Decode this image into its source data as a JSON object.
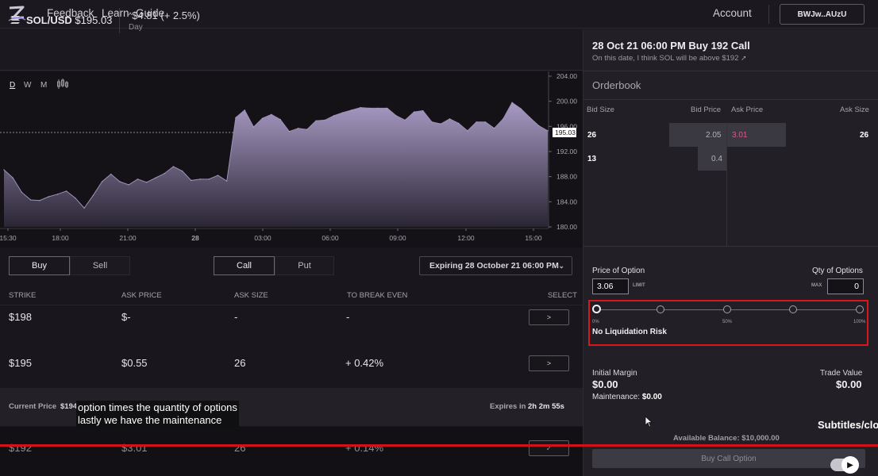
{
  "nav": {
    "links": [
      "Feedback",
      "Learn",
      "Guide"
    ],
    "account": "Account",
    "wallet": "BWJw..AUzU"
  },
  "ticker": {
    "pair": "SOL/USD",
    "price": "$195.03",
    "change": "$4.81 (+ 2.5%)",
    "period": "Day"
  },
  "timeframes": [
    "D",
    "W",
    "M"
  ],
  "chart_data": {
    "type": "area",
    "x_ticks": [
      "15:30",
      "18:00",
      "21:00",
      "28",
      "03:00",
      "06:00",
      "09:00",
      "12:00",
      "15:00"
    ],
    "y_ticks": [
      204.0,
      200.0,
      196.0,
      192.0,
      188.0,
      184.0,
      180.0
    ],
    "ylim": [
      180,
      204
    ],
    "current_label": "195.03",
    "current_value": 195.03,
    "values": [
      189.1,
      187.8,
      185.5,
      184.3,
      184.2,
      184.8,
      185.2,
      185.7,
      184.6,
      183.0,
      185.0,
      187.2,
      188.4,
      187.2,
      186.7,
      187.6,
      187.1,
      187.8,
      188.5,
      189.6,
      188.9,
      187.4,
      187.6,
      187.6,
      188.2,
      187.3,
      197.4,
      198.6,
      195.9,
      197.3,
      197.9,
      197.1,
      195.2,
      195.7,
      195.5,
      196.9,
      197.0,
      197.7,
      198.2,
      198.6,
      199.0,
      198.9,
      198.9,
      198.9,
      197.7,
      197.0,
      198.3,
      198.5,
      196.7,
      196.4,
      197.2,
      196.5,
      195.3,
      196.7,
      196.7,
      195.7,
      197.2,
      199.8,
      198.8,
      197.4,
      196.1,
      195.3
    ],
    "grid": false
  },
  "options": {
    "side": [
      "Buy",
      "Sell"
    ],
    "kind": [
      "Call",
      "Put"
    ],
    "expiry": "Expiring 28 October 21 06:00 PM",
    "headers": [
      "STRIKE",
      "ASK PRICE",
      "ASK SIZE",
      "TO BREAK EVEN",
      "SELECT"
    ],
    "rows": [
      {
        "strike": "$198",
        "ask": "$-",
        "size": "-",
        "breakeven": "-"
      },
      {
        "strike": "$195",
        "ask": "$0.55",
        "size": "26",
        "breakeven": "+ 0.42%"
      },
      {
        "strike": "$192",
        "ask": "$3.01",
        "size": "26",
        "breakeven": "+ 0.14%"
      }
    ],
    "select_glyph": ">",
    "selected_glyph": "✓",
    "current_price_label": "Current Price",
    "current_price_value": "$194",
    "expires_label": "Expires in",
    "expires_value": "2h 2m 55s"
  },
  "caption": {
    "line1": "option times the quantity of options",
    "line2": "lastly we have the maintenance"
  },
  "panel": {
    "title": "28 Oct 21 06:00 PM Buy 192 Call",
    "subtitle": "On this date, I think SOL will be above $192",
    "orderbook_title": "Orderbook",
    "ob_headers": [
      "Bid Size",
      "Bid Price",
      "Ask Price",
      "Ask Size"
    ],
    "ob_rows": [
      {
        "bid_size": "26",
        "bid_price": "2.05",
        "ask_price": "3.01",
        "ask_size": "26"
      },
      {
        "bid_size": "13",
        "bid_price": "0.4",
        "ask_price": "",
        "ask_size": ""
      }
    ],
    "price_label": "Price of Option",
    "price_value": "3.06",
    "limit_tag": "LIMIT",
    "qty_label": "Qty of Options",
    "max_tag": "MAX",
    "qty_value": "0",
    "slider_level": 0,
    "slider_marks": [
      "0%",
      "50%",
      "100%"
    ],
    "liquidation": "No Liquidation Risk",
    "initial_margin_label": "Initial Margin",
    "initial_margin": "$0.00",
    "trade_value_label": "Trade Value",
    "trade_value": "$0.00",
    "maintenance_label": "Maintenance:",
    "maintenance_value": "$0.00",
    "available_balance": "Available Balance: $10,000.00",
    "buy_button": "Buy Call Option",
    "subtitles_text": "Subtitles/clos"
  },
  "colors": {
    "ask_price": "#e0568c",
    "area_top": "#a89ac4",
    "area_bottom": "#2a2534",
    "highlight": "#d8161b"
  },
  "video_progress": 1.0
}
